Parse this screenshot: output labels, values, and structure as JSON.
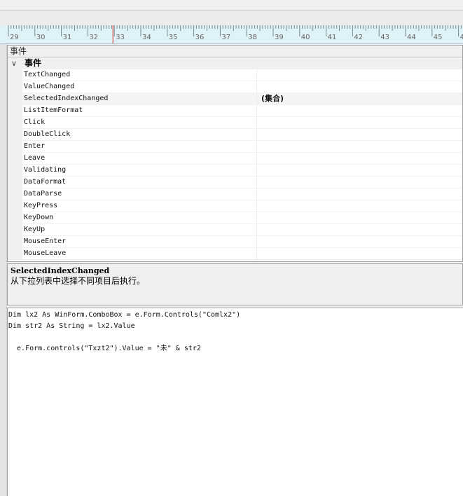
{
  "ruler": {
    "labels": [
      "29",
      "30",
      "31",
      "32",
      "33",
      "34",
      "35",
      "36",
      "37",
      "38",
      "39",
      "40",
      "41",
      "42",
      "43",
      "44",
      "45",
      "4"
    ],
    "marker_value": 33
  },
  "property_grid": {
    "header": "事件",
    "category": "事件",
    "rows": [
      {
        "name": "TextChanged",
        "value": ""
      },
      {
        "name": "ValueChanged",
        "value": ""
      },
      {
        "name": "SelectedIndexChanged",
        "value": "(集合)"
      },
      {
        "name": "ListItemFormat",
        "value": ""
      },
      {
        "name": "Click",
        "value": ""
      },
      {
        "name": "DoubleClick",
        "value": ""
      },
      {
        "name": "Enter",
        "value": ""
      },
      {
        "name": "Leave",
        "value": ""
      },
      {
        "name": "Validating",
        "value": ""
      },
      {
        "name": "DataFormat",
        "value": ""
      },
      {
        "name": "DataParse",
        "value": ""
      },
      {
        "name": "KeyPress",
        "value": ""
      },
      {
        "name": "KeyDown",
        "value": ""
      },
      {
        "name": "KeyUp",
        "value": ""
      },
      {
        "name": "MouseEnter",
        "value": ""
      },
      {
        "name": "MouseLeave",
        "value": ""
      }
    ]
  },
  "help": {
    "title": "SelectedIndexChanged",
    "description": "从下拉列表中选择不同项目后执行。"
  },
  "code": {
    "lines": [
      "Dim lx2 As WinForm.ComboBox = e.Form.Controls(\"Comlx2\")",
      "Dim str2 As String = lx2.Value",
      "",
      "  e.Form.controls(\"Txzt2\").Value = \"未\" & str2"
    ]
  }
}
